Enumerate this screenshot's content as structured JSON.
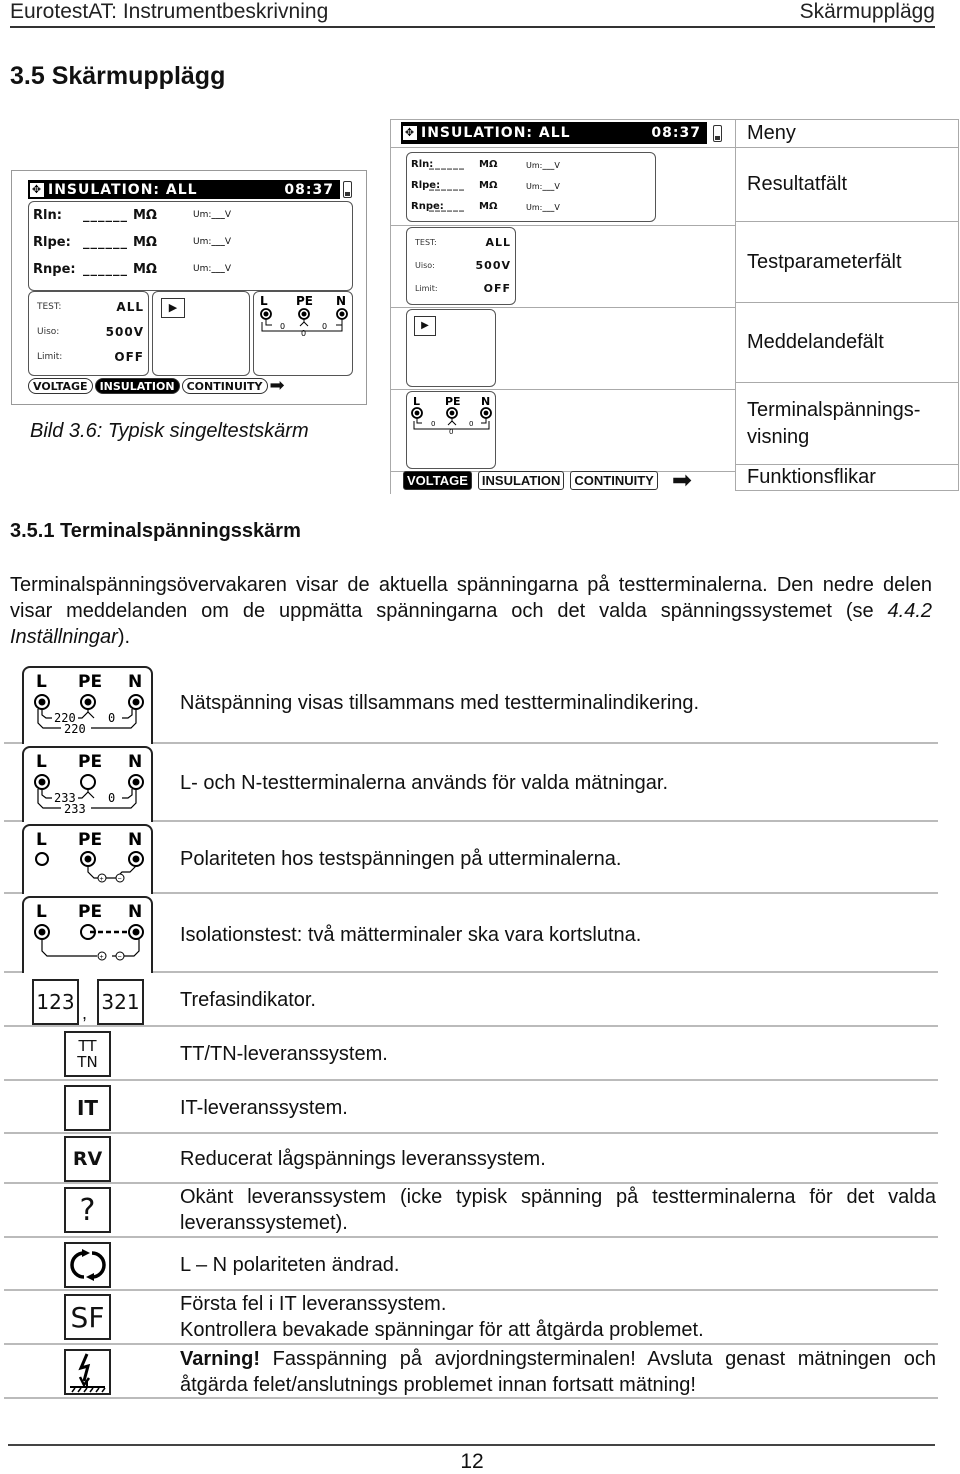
{
  "header": {
    "left": "EurotestAT: Instrumentbeskrivning",
    "right": "Skärmupplägg"
  },
  "section_title": "3.5  Skärmupplägg",
  "figure": {
    "caption": "Bild 3.6: Typisk singeltestskärm",
    "screen": {
      "title": "INSULATION: ALL",
      "time": "08:37",
      "results": [
        {
          "label": "Rln:",
          "value": "___",
          "unit": "MΩ",
          "um_label": "Um:",
          "um_value": "___",
          "um_unit": "V"
        },
        {
          "label": "Rlpe:",
          "value": "___",
          "unit": "MΩ",
          "um_label": "Um:",
          "um_value": "___",
          "um_unit": "V"
        },
        {
          "label": "Rnpe:",
          "value": "___",
          "unit": "MΩ",
          "um_label": "Um:",
          "um_value": "___",
          "um_unit": "V"
        }
      ],
      "params": [
        {
          "label": "TEST:",
          "value": "ALL"
        },
        {
          "label": "Uiso:",
          "value": "500V"
        },
        {
          "label": "Limit:",
          "value": "OFF"
        }
      ],
      "terminals": {
        "labels": [
          "L",
          "PE",
          "N"
        ],
        "values": [
          "0",
          "0",
          "0"
        ]
      },
      "tabs": [
        "VOLTAGE",
        "INSULATION",
        "CONTINUITY"
      ],
      "active_tab_single": "INSULATION",
      "active_tab_exploded": "VOLTAGE"
    }
  },
  "annotations": [
    "Meny",
    "Resultatfält",
    "Testparameterfält",
    "Meddelandefält",
    "Terminalspännings-\nvisning",
    "Funktionsflikar"
  ],
  "subsection_title": "3.5.1  Terminalspänningsskärm",
  "paragraph": {
    "before": "Terminalspänningsövervakaren visar de aktuella spänningarna på testterminalerna. Den nedre delen visar meddelanden om de uppmätta spänningarna och det valda spänningssystemet (se ",
    "link": "4.4.2 Inställningar",
    "after": ")."
  },
  "terminal_rows": [
    {
      "icon": "terminal-voltage-220",
      "values": [
        "220",
        "0",
        "220"
      ],
      "text": "Nätspänning visas tillsammans med testterminalindikering."
    },
    {
      "icon": "terminal-voltage-233",
      "values": [
        "233",
        "0",
        "233"
      ],
      "text": "L- och N-testterminalerna används för valda mätningar."
    },
    {
      "icon": "terminal-polarity",
      "text": "Polariteten hos testspänningen på utterminalerna."
    },
    {
      "icon": "terminal-short",
      "text": "Isolationstest: två mätterminaler ska vara kortslutna."
    }
  ],
  "icon_rows": [
    {
      "icon": "phase-sequence",
      "glyphs": [
        "123",
        "321"
      ],
      "sep": ",",
      "text": "Trefasindikator."
    },
    {
      "icon": "tt-tn",
      "glyph": "TT\nTN",
      "text": "TT/TN-leveranssystem."
    },
    {
      "icon": "it",
      "glyph": "IT",
      "text": "IT-leveranssystem."
    },
    {
      "icon": "rv",
      "glyph": "RV",
      "text": "Reducerat lågspännings leveranssystem."
    },
    {
      "icon": "unknown",
      "glyph": "?",
      "text": "Okänt leveranssystem (icke typisk spänning på testterminalerna för det valda leveranssystemet)."
    },
    {
      "icon": "polarity-swap",
      "text": "L – N polariteten ändrad."
    },
    {
      "icon": "sf",
      "glyph": "SF",
      "text1": "Första fel i IT leveranssystem.",
      "text2": "Kontrollera bevakade spänningar för att åtgärda problemet."
    },
    {
      "icon": "pe-warning",
      "bold": "Varning!",
      "text": " Fasspänning på avjordningsterminalen! Avsluta genast mätningen och åtgärda felet/anslutnings problemet innan fortsatt mätning!"
    }
  ],
  "page_number": "12"
}
